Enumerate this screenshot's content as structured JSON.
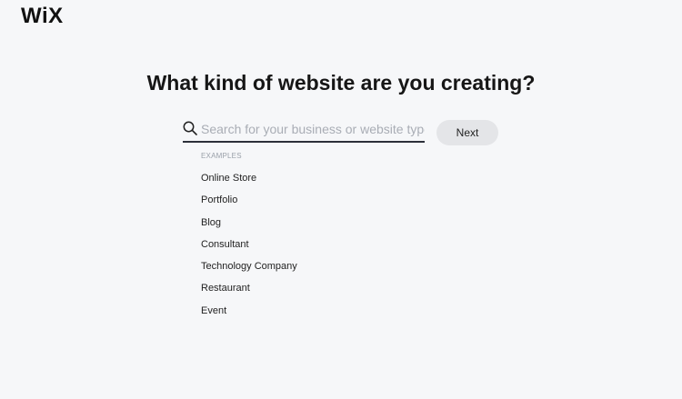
{
  "brand": {
    "logo_text": "WiX"
  },
  "header": {
    "title": "What kind of website are you creating?"
  },
  "search": {
    "placeholder": "Search for your business or website type",
    "value": ""
  },
  "next_button": {
    "label": "Next"
  },
  "examples": {
    "label": "EXAMPLES",
    "items": [
      "Online Store",
      "Portfolio",
      "Blog",
      "Consultant",
      "Technology Company",
      "Restaurant",
      "Event"
    ]
  },
  "icons": {
    "search": "search-icon"
  },
  "colors": {
    "background": "#f6f7f9",
    "underline": "#2b2f3a",
    "button_bg": "#e4e5e8",
    "placeholder": "#a9adb5",
    "muted_label": "#9aa0a9"
  }
}
